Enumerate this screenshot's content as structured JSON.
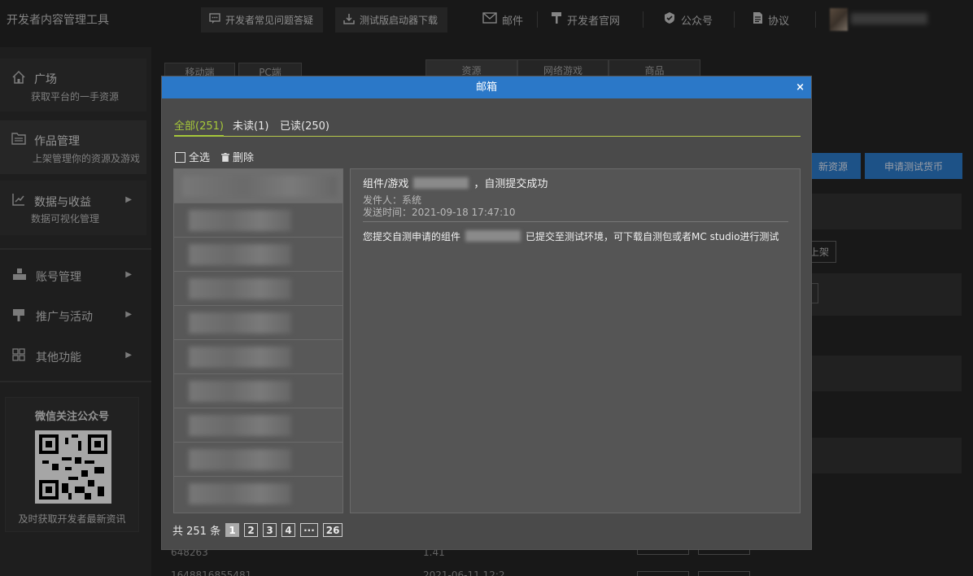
{
  "app_title": "开发者内容管理工具",
  "topbar": {
    "faq": "开发者常见问题答疑",
    "launcher": "测试版启动器下载",
    "mail": "邮件",
    "website": "开发者官网",
    "official_account": "公众号",
    "agreement": "协议"
  },
  "sidebar": {
    "plaza": {
      "title": "广场",
      "sub": "获取平台的一手资源"
    },
    "works": {
      "title": "作品管理",
      "sub": "上架管理你的资源及游戏"
    },
    "data": {
      "title": "数据与收益",
      "sub": "数据可视化管理"
    },
    "account": "账号管理",
    "promo": "推广与活动",
    "other": "其他功能",
    "wechat_title": "微信关注公众号",
    "wechat_sub": "及时获取开发者最新资讯"
  },
  "background": {
    "mobile_tab": "移动端",
    "pc_tab": "PC端",
    "resource_tab": "资源",
    "online_game_tab": "网络游戏",
    "goods_tab": "商品",
    "new_resource_btn": "新资源",
    "apply_currency_btn": "申请测试货币",
    "listing_btn": "上架",
    "row_id_1": "648263",
    "row_val_1": "1.41",
    "row_id_2": "1648816855481",
    "row_val_2": "2021-06-11 12:2"
  },
  "modal": {
    "title": "邮箱",
    "close": "×",
    "tabs": {
      "all": "全部(251)",
      "unread": "未读(1)",
      "read": "已读(250)"
    },
    "select_all": "全选",
    "delete": "删除",
    "detail": {
      "title_prefix": "组件/游戏",
      "title_suffix": "，自测提交成功",
      "sender": "发件人：系统",
      "time": "发送时间：2021-09-18 17:47:10",
      "body_prefix": "您提交自测申请的组件",
      "body_suffix": "已提交至测试环境，可下载自测包或者MC studio进行测试"
    },
    "pager": {
      "total": "共 251 条",
      "pages": [
        "1",
        "2",
        "3",
        "4",
        "···",
        "26"
      ]
    }
  }
}
